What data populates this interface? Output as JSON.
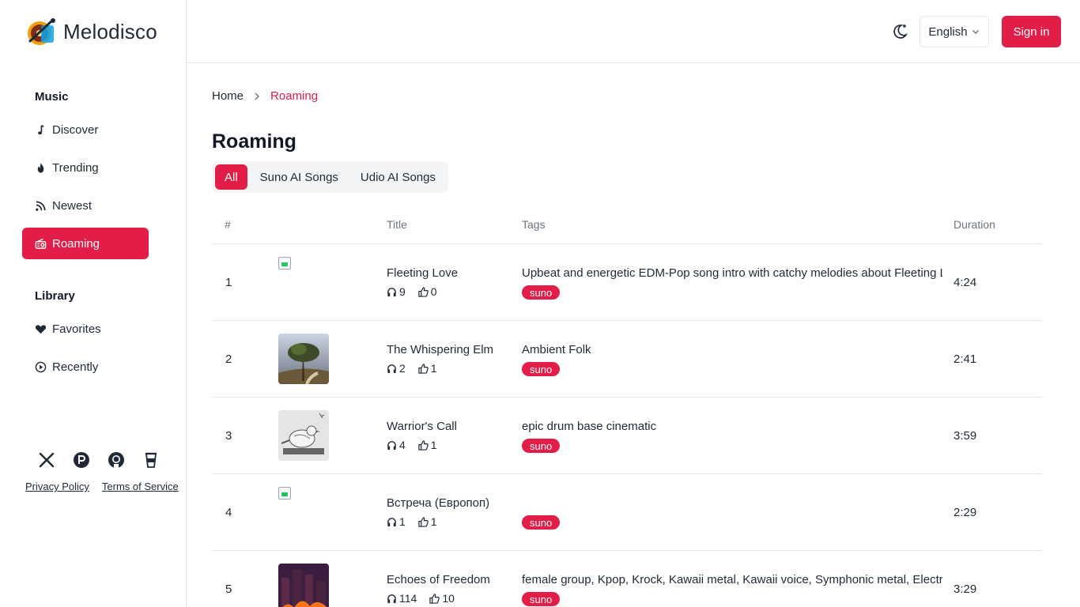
{
  "brand": {
    "name": "Melodisco"
  },
  "sidebar": {
    "music_title": "Music",
    "music_items": [
      {
        "label": "Discover",
        "icon": "music-note-icon"
      },
      {
        "label": "Trending",
        "icon": "flame-icon"
      },
      {
        "label": "Newest",
        "icon": "rss-icon"
      },
      {
        "label": "Roaming",
        "icon": "radio-icon"
      }
    ],
    "library_title": "Library",
    "library_items": [
      {
        "label": "Favorites",
        "icon": "heart-icon"
      },
      {
        "label": "Recently",
        "icon": "play-circle-icon"
      }
    ],
    "socials": [
      "x-icon",
      "producthunt-icon",
      "github-icon",
      "coffee-icon"
    ],
    "privacy": "Privacy Policy",
    "terms": "Terms of Service"
  },
  "header": {
    "language": "English",
    "sign_in": "Sign in"
  },
  "breadcrumb": {
    "home": "Home",
    "current": "Roaming"
  },
  "page": {
    "title": "Roaming"
  },
  "tabs": [
    "All",
    "Suno AI Songs",
    "Udio AI Songs"
  ],
  "table": {
    "headers": {
      "num": "#",
      "title": "Title",
      "tags": "Tags",
      "duration": "Duration"
    },
    "rows": [
      {
        "num": "1",
        "title": "Fleeting Love",
        "plays": "9",
        "likes": "0",
        "tags": "Upbeat and energetic EDM-Pop song intro with catchy melodies about Fleeting Love",
        "badge": "suno",
        "duration": "4:24"
      },
      {
        "num": "2",
        "title": "The Whispering Elm",
        "plays": "2",
        "likes": "1",
        "tags": "Ambient Folk",
        "badge": "suno",
        "duration": "2:41"
      },
      {
        "num": "3",
        "title": "Warrior's Call",
        "plays": "4",
        "likes": "1",
        "tags": "epic drum base cinematic",
        "badge": "suno",
        "duration": "3:59"
      },
      {
        "num": "4",
        "title": "Встреча (Европоп)",
        "plays": "1",
        "likes": "1",
        "tags": "",
        "badge": "suno",
        "duration": "2:29"
      },
      {
        "num": "5",
        "title": "Echoes of Freedom",
        "plays": "114",
        "likes": "10",
        "tags": "female group, Kpop, Krock, Kawaii metal, Kawaii voice, Symphonic metal, Electronic",
        "badge": "suno",
        "duration": "3:29"
      }
    ]
  }
}
